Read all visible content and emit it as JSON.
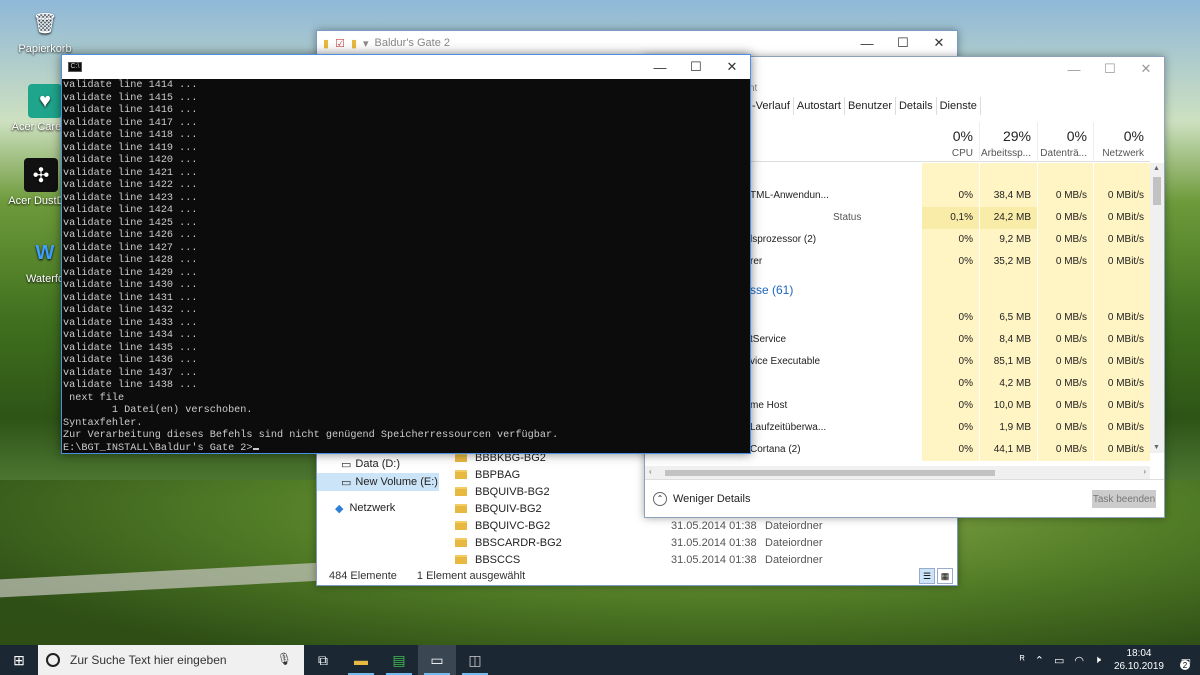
{
  "desktop": {
    "icons": [
      {
        "label": "Papierkorb",
        "icon": "recycle-bin-icon"
      },
      {
        "label": "Acer Care Ce",
        "icon": "acer-care-icon"
      },
      {
        "label": "Acer DustDef",
        "icon": "dust-defender-icon"
      },
      {
        "label": "Waterfo",
        "icon": "waterfox-icon"
      }
    ]
  },
  "explorer": {
    "title": "Baldur's Gate 2",
    "nav": [
      "Data (D:)",
      "New Volume (E:)",
      "Netzwerk"
    ],
    "files": [
      {
        "name": "BBBKBG-BG2",
        "date": "",
        "type": ""
      },
      {
        "name": "BBPBAG",
        "date": "",
        "type": ""
      },
      {
        "name": "BBQUIVB-BG2",
        "date": "",
        "type": ""
      },
      {
        "name": "BBQUIV-BG2",
        "date": "",
        "type": ""
      },
      {
        "name": "BBQUIVC-BG2",
        "date": "31.05.2014 01:38",
        "type": "Dateiordner"
      },
      {
        "name": "BBSCARDR-BG2",
        "date": "31.05.2014 01:38",
        "type": "Dateiordner"
      },
      {
        "name": "BBSCCS",
        "date": "31.05.2014 01:38",
        "type": "Dateiordner"
      }
    ],
    "status_count": "484 Elemente",
    "status_selected": "1 Element ausgewählt"
  },
  "taskmgr": {
    "title_fragment": "nt",
    "tabs": [
      "-Verlauf",
      "Autostart",
      "Benutzer",
      "Details",
      "Dienste"
    ],
    "columns": [
      {
        "pct": "",
        "label": "Status"
      },
      {
        "pct": "0%",
        "label": "CPU"
      },
      {
        "pct": "29%",
        "label": "Arbeitssp..."
      },
      {
        "pct": "0%",
        "label": "Datenträ..."
      },
      {
        "pct": "0%",
        "label": "Netzwerk"
      }
    ],
    "rows": [
      {
        "name": "",
        "cpu": "",
        "mem": "",
        "disk": "",
        "net": ""
      },
      {
        "name": "TML-Anwendun...",
        "cpu": "0%",
        "mem": "38,4 MB",
        "disk": "0 MB/s",
        "net": "0 MBit/s"
      },
      {
        "name": "",
        "cpu": "0,1%",
        "mem": "24,2 MB",
        "disk": "0 MB/s",
        "net": "0 MBit/s"
      },
      {
        "name": "lsprozessor (2)",
        "cpu": "0%",
        "mem": "9,2 MB",
        "disk": "0 MB/s",
        "net": "0 MBit/s"
      },
      {
        "name": "rer",
        "cpu": "0%",
        "mem": "35,2 MB",
        "disk": "0 MB/s",
        "net": "0 MBit/s"
      },
      {
        "name": "sse (61)",
        "section": true
      },
      {
        "name": "",
        "cpu": "0%",
        "mem": "6,5 MB",
        "disk": "0 MB/s",
        "net": "0 MBit/s"
      },
      {
        "name": "tService",
        "cpu": "0%",
        "mem": "8,4 MB",
        "disk": "0 MB/s",
        "net": "0 MBit/s"
      },
      {
        "name": "vice Executable",
        "cpu": "0%",
        "mem": "85,1 MB",
        "disk": "0 MB/s",
        "net": "0 MBit/s"
      },
      {
        "name": "",
        "cpu": "0%",
        "mem": "4,2 MB",
        "disk": "0 MB/s",
        "net": "0 MBit/s"
      },
      {
        "name": "me Host",
        "cpu": "0%",
        "mem": "10,0 MB",
        "disk": "0 MB/s",
        "net": "0 MBit/s"
      },
      {
        "name": "Laufzeitüberwa...",
        "cpu": "0%",
        "mem": "1,9 MB",
        "disk": "0 MB/s",
        "net": "0 MBit/s"
      },
      {
        "name": "Cortana (2)",
        "cpu": "0%",
        "mem": "44,1 MB",
        "disk": "0 MB/s",
        "net": "0 MBit/s"
      }
    ],
    "fewer_details": "Weniger Details",
    "end_task": "Task beenden"
  },
  "cmd": {
    "lines": [
      "validate line 1414 ...",
      "validate line 1415 ...",
      "validate line 1416 ...",
      "validate line 1417 ...",
      "validate line 1418 ...",
      "validate line 1419 ...",
      "validate line 1420 ...",
      "validate line 1421 ...",
      "validate line 1422 ...",
      "validate line 1423 ...",
      "validate line 1424 ...",
      "validate line 1425 ...",
      "validate line 1426 ...",
      "validate line 1427 ...",
      "validate line 1428 ...",
      "validate line 1429 ...",
      "validate line 1430 ...",
      "validate line 1431 ...",
      "validate line 1432 ...",
      "validate line 1433 ...",
      "validate line 1434 ...",
      "validate line 1435 ...",
      "validate line 1436 ...",
      "validate line 1437 ...",
      "validate line 1438 ...",
      " next file",
      "        1 Datei(en) verschoben.",
      "Syntaxfehler.",
      "Zur Verarbeitung dieses Befehls sind nicht genügend Speicherressourcen verfügbar."
    ],
    "prompt": "E:\\BGT_INSTALL\\Baldur's Gate 2>"
  },
  "taskbar": {
    "search_placeholder": "Zur Suche Text hier eingeben",
    "time": "18:04",
    "date": "26.10.2019",
    "notification_count": "2",
    "input_label": "¶x"
  }
}
